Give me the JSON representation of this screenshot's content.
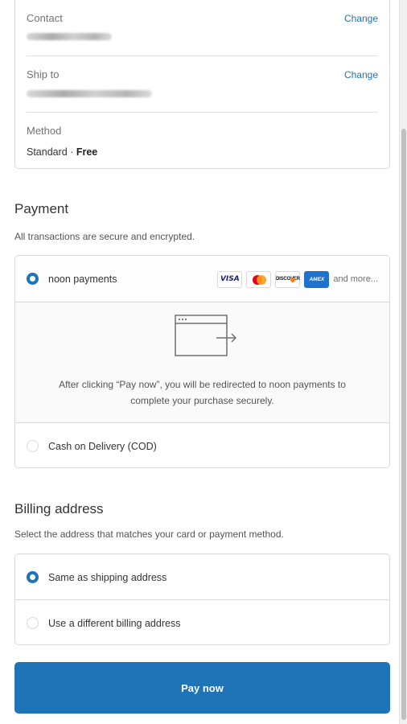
{
  "review": {
    "contact": {
      "label": "Contact",
      "change": "Change"
    },
    "ship_to": {
      "label": "Ship to",
      "change": "Change"
    },
    "method": {
      "label": "Method",
      "value_prefix": "Standard · ",
      "value_bold": "Free"
    }
  },
  "payment": {
    "title": "Payment",
    "subtitle": "All transactions are secure and encrypted.",
    "options": [
      {
        "label": "noon payments",
        "selected": true
      },
      {
        "label": "Cash on Delivery (COD)",
        "selected": false
      }
    ],
    "card_logos": {
      "visa": "VISA",
      "discover": "DISCOVER",
      "amex": "AMEX",
      "more": "and more..."
    },
    "redirect_text": "After clicking “Pay now”, you will be redirected to noon payments to complete your purchase securely."
  },
  "billing": {
    "title": "Billing address",
    "subtitle": "Select the address that matches your card or payment method.",
    "options": [
      {
        "label": "Same as shipping address",
        "selected": true
      },
      {
        "label": "Use a different billing address",
        "selected": false
      }
    ]
  },
  "pay_button": {
    "label": "Pay now"
  },
  "colors": {
    "accent": "#1f73b7",
    "border": "#d9d9d9",
    "muted_text": "#737373"
  }
}
